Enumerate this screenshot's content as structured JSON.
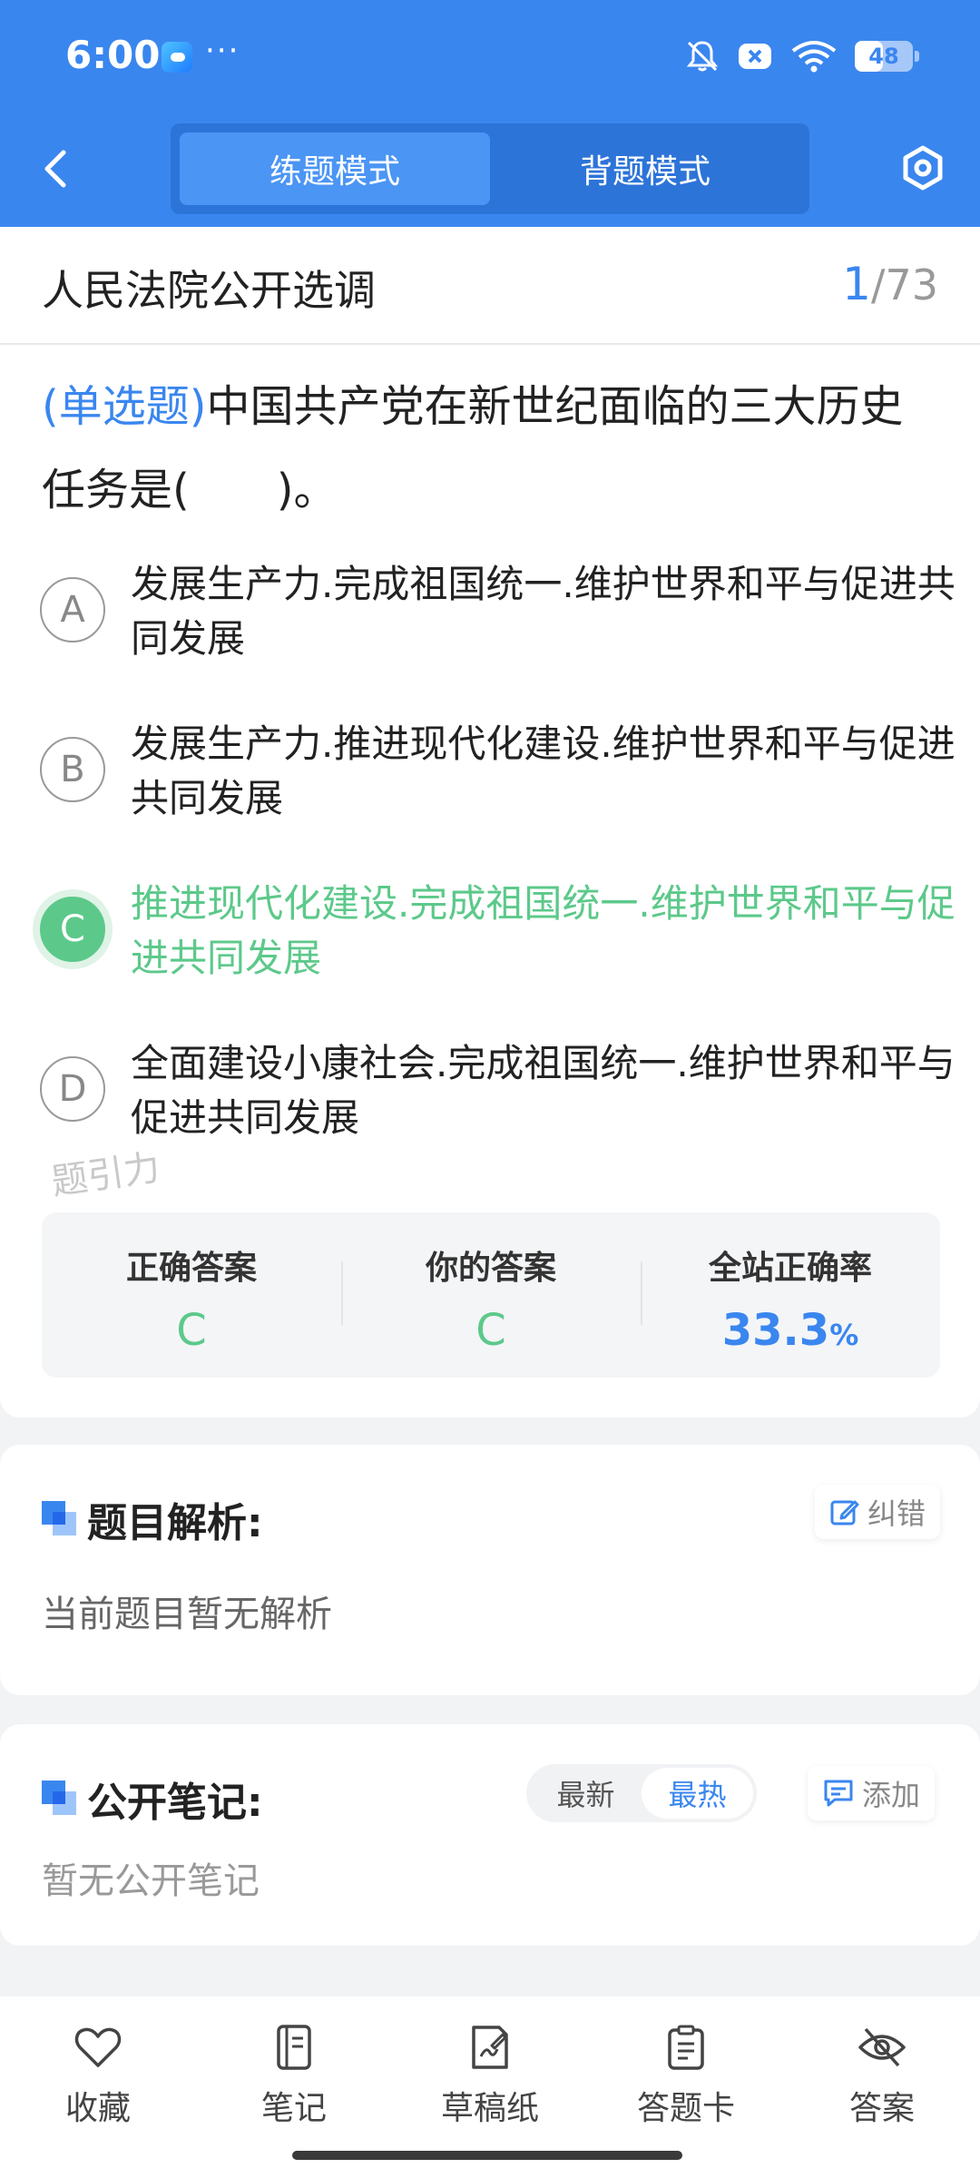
{
  "status": {
    "time": "6:00",
    "more": "···",
    "battery": "48",
    "battery_level": 0.48
  },
  "nav": {
    "modes": [
      {
        "label": "练题模式",
        "active": true
      },
      {
        "label": "背题模式",
        "active": false
      }
    ]
  },
  "question": {
    "source": "人民法院公开选调",
    "progress_current": "1",
    "progress_total": "/73",
    "type": "(单选题)",
    "stem": "中国共产党在新世纪面临的三大历史任务是(　　)。",
    "options": [
      {
        "letter": "A",
        "text": "发展生产力.完成祖国统一.维护世界和平与促进共同发展",
        "correct": false
      },
      {
        "letter": "B",
        "text": "发展生产力.推进现代化建设.维护世界和平与促进共同发展",
        "correct": false
      },
      {
        "letter": "C",
        "text": "推进现代化建设.完成祖国统一.维护世界和平与促进共同发展",
        "correct": true
      },
      {
        "letter": "D",
        "text": "全面建设小康社会.完成祖国统一.维护世界和平与促进共同发展",
        "correct": false
      }
    ],
    "watermark": "题引力"
  },
  "stats": {
    "correct_label": "正确答案",
    "correct_value": "C",
    "yours_label": "你的答案",
    "yours_value": "C",
    "rate_label": "全站正确率",
    "rate_value": "33.3",
    "rate_unit": "%"
  },
  "analysis": {
    "title": "题目解析:",
    "report_label": "纠错",
    "body": "当前题目暂无解析"
  },
  "notes": {
    "title": "公开笔记:",
    "sort_latest": "最新",
    "sort_hot": "最热",
    "add_label": "添加",
    "body": "暂无公开笔记"
  },
  "toolbar": {
    "favorite": "收藏",
    "notes": "笔记",
    "draft": "草稿纸",
    "answer_card": "答题卡",
    "answer": "答案"
  },
  "colors": {
    "primary": "#3a86ef",
    "correct": "#5cc98a"
  }
}
